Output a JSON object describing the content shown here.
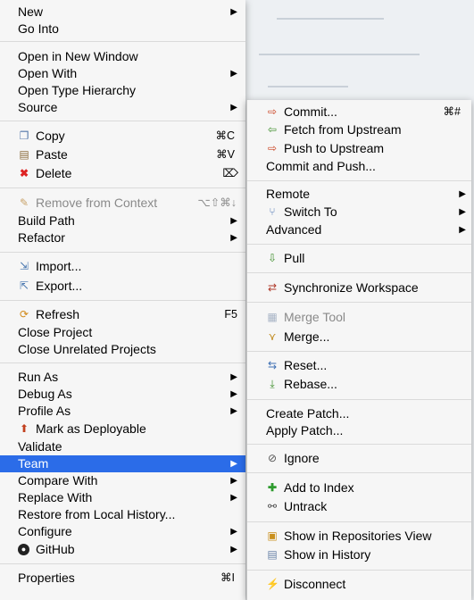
{
  "main_menu": {
    "items": [
      {
        "label": "New",
        "arrow": true
      },
      {
        "label": "Go Into"
      },
      {
        "label": "Open in New Window"
      },
      {
        "label": "Open With",
        "arrow": true
      },
      {
        "label": "Open Type Hierarchy"
      },
      {
        "label": "Source",
        "arrow": true
      },
      {
        "label": "Copy",
        "shortcut": "⌘C",
        "icon": "copy-icon"
      },
      {
        "label": "Paste",
        "shortcut": "⌘V",
        "icon": "paste-icon"
      },
      {
        "label": "Delete",
        "shortcut": "⌦",
        "icon": "delete-icon"
      },
      {
        "label": "Remove from Context",
        "shortcut": "⌥⇧⌘↓",
        "icon": "remove-context-icon",
        "disabled": true
      },
      {
        "label": "Build Path",
        "arrow": true
      },
      {
        "label": "Refactor",
        "arrow": true
      },
      {
        "label": "Import...",
        "icon": "import-icon"
      },
      {
        "label": "Export...",
        "icon": "export-icon"
      },
      {
        "label": "Refresh",
        "shortcut": "F5",
        "icon": "refresh-icon"
      },
      {
        "label": "Close Project"
      },
      {
        "label": "Close Unrelated Projects"
      },
      {
        "label": "Run As",
        "arrow": true
      },
      {
        "label": "Debug As",
        "arrow": true
      },
      {
        "label": "Profile As",
        "arrow": true
      },
      {
        "label": "Mark as Deployable",
        "icon": "deployable-icon"
      },
      {
        "label": "Validate"
      },
      {
        "label": "Team",
        "arrow": true,
        "highlighted": true
      },
      {
        "label": "Compare With",
        "arrow": true
      },
      {
        "label": "Replace With",
        "arrow": true
      },
      {
        "label": "Restore from Local History..."
      },
      {
        "label": "Configure",
        "arrow": true
      },
      {
        "label": "GitHub",
        "arrow": true,
        "icon": "github-icon"
      },
      {
        "label": "Properties",
        "shortcut": "⌘I"
      }
    ]
  },
  "team_menu": {
    "items": [
      {
        "label": "Commit...",
        "shortcut": "⌘#",
        "icon": "commit-icon"
      },
      {
        "label": "Fetch from Upstream",
        "icon": "fetch-icon"
      },
      {
        "label": "Push to Upstream",
        "icon": "push-icon"
      },
      {
        "label": "Commit and Push..."
      },
      {
        "label": "Remote",
        "arrow": true
      },
      {
        "label": "Switch To",
        "arrow": true,
        "icon": "switch-branch-icon"
      },
      {
        "label": "Advanced",
        "arrow": true
      },
      {
        "label": "Pull",
        "icon": "pull-icon"
      },
      {
        "label": "Synchronize Workspace",
        "icon": "synchronize-icon"
      },
      {
        "label": "Merge Tool",
        "icon": "merge-tool-icon",
        "disabled": true
      },
      {
        "label": "Merge...",
        "icon": "merge-icon"
      },
      {
        "label": "Reset...",
        "icon": "reset-icon"
      },
      {
        "label": "Rebase...",
        "icon": "rebase-icon"
      },
      {
        "label": "Create Patch..."
      },
      {
        "label": "Apply Patch..."
      },
      {
        "label": "Ignore",
        "icon": "ignore-icon"
      },
      {
        "label": "Add to Index",
        "icon": "add-to-index-icon"
      },
      {
        "label": "Untrack",
        "icon": "untrack-icon"
      },
      {
        "label": "Show in Repositories View",
        "icon": "repositories-icon"
      },
      {
        "label": "Show in History",
        "icon": "history-icon"
      },
      {
        "label": "Disconnect",
        "icon": "disconnect-icon"
      }
    ]
  },
  "colors": {
    "highlight": "#2b6ce8",
    "menu_bg": "#f6f6f6",
    "separator": "#dadada",
    "disabled_text": "#8a8a8a"
  }
}
